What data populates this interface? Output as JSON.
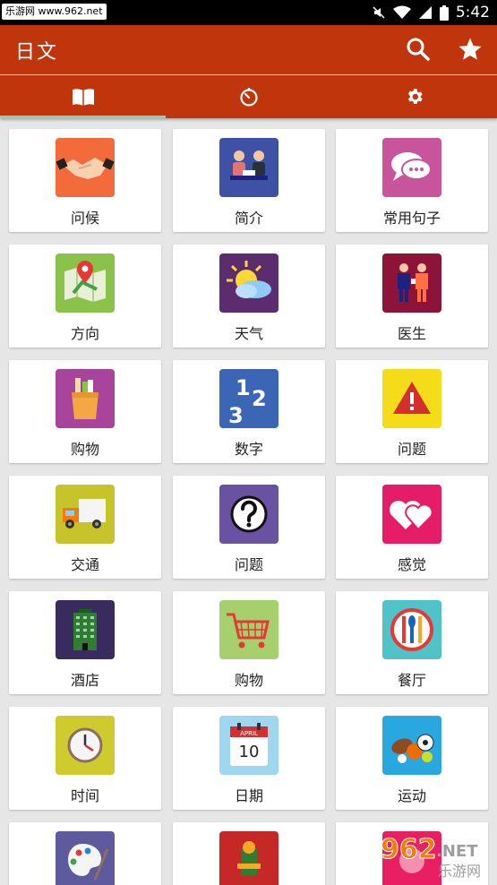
{
  "status_bar": {
    "watermark": "乐游网 www.962.net",
    "time": "5:42"
  },
  "app_bar": {
    "title": "日文",
    "icons": [
      "search-icon",
      "star-icon"
    ]
  },
  "tabs": [
    {
      "icon": "book-icon",
      "selected": true
    },
    {
      "icon": "timer-icon",
      "selected": false
    },
    {
      "icon": "gear-icon",
      "selected": false
    }
  ],
  "categories": [
    {
      "label": "问候",
      "icon": "handshake-icon",
      "color": "#f36b3a"
    },
    {
      "label": "简介",
      "icon": "meeting-icon",
      "color": "#3f51a5"
    },
    {
      "label": "常用句子",
      "icon": "chat-bubble-icon",
      "color": "#c8549b"
    },
    {
      "label": "方向",
      "icon": "map-pin-icon",
      "color": "#8bc34a"
    },
    {
      "label": "天气",
      "icon": "sun-cloud-icon",
      "color": "#5b2d6e"
    },
    {
      "label": "医生",
      "icon": "doctor-icon",
      "color": "#8e1338"
    },
    {
      "label": "购物",
      "icon": "shopping-bag-icon",
      "color": "#a8449b"
    },
    {
      "label": "数字",
      "icon": "numbers-icon",
      "color": "#3b66b5"
    },
    {
      "label": "问题",
      "icon": "warning-icon",
      "color": "#f4dc19"
    },
    {
      "label": "交通",
      "icon": "truck-icon",
      "color": "#c7c42b"
    },
    {
      "label": "问题",
      "icon": "question-icon",
      "color": "#6a52a3"
    },
    {
      "label": "感觉",
      "icon": "hearts-icon",
      "color": "#e51c67"
    },
    {
      "label": "酒店",
      "icon": "hotel-building-icon",
      "color": "#3a2b5e"
    },
    {
      "label": "购物",
      "icon": "shopping-cart-icon",
      "color": "#a6d06d"
    },
    {
      "label": "餐厅",
      "icon": "restaurant-icon",
      "color": "#4fc3c7"
    },
    {
      "label": "时间",
      "icon": "clock-icon",
      "color": "#cfcb2e"
    },
    {
      "label": "日期",
      "icon": "calendar-icon",
      "color": "#9fd6f0"
    },
    {
      "label": "运动",
      "icon": "sports-balls-icon",
      "color": "#29a8e0"
    },
    {
      "label": "",
      "icon": "palette-icon",
      "color": "#5d5a9e"
    },
    {
      "label": "",
      "icon": "festival-icon",
      "color": "#c62828"
    },
    {
      "label": "",
      "icon": "other-icon",
      "color": "#e91e63"
    }
  ],
  "calendar": {
    "month": "APRIL",
    "day": "10"
  },
  "numbers_glyphs": [
    "1",
    "2",
    "3"
  ],
  "bottom_watermark": {
    "main": "962",
    "suffix": ".NET",
    "sub": "乐游网"
  }
}
